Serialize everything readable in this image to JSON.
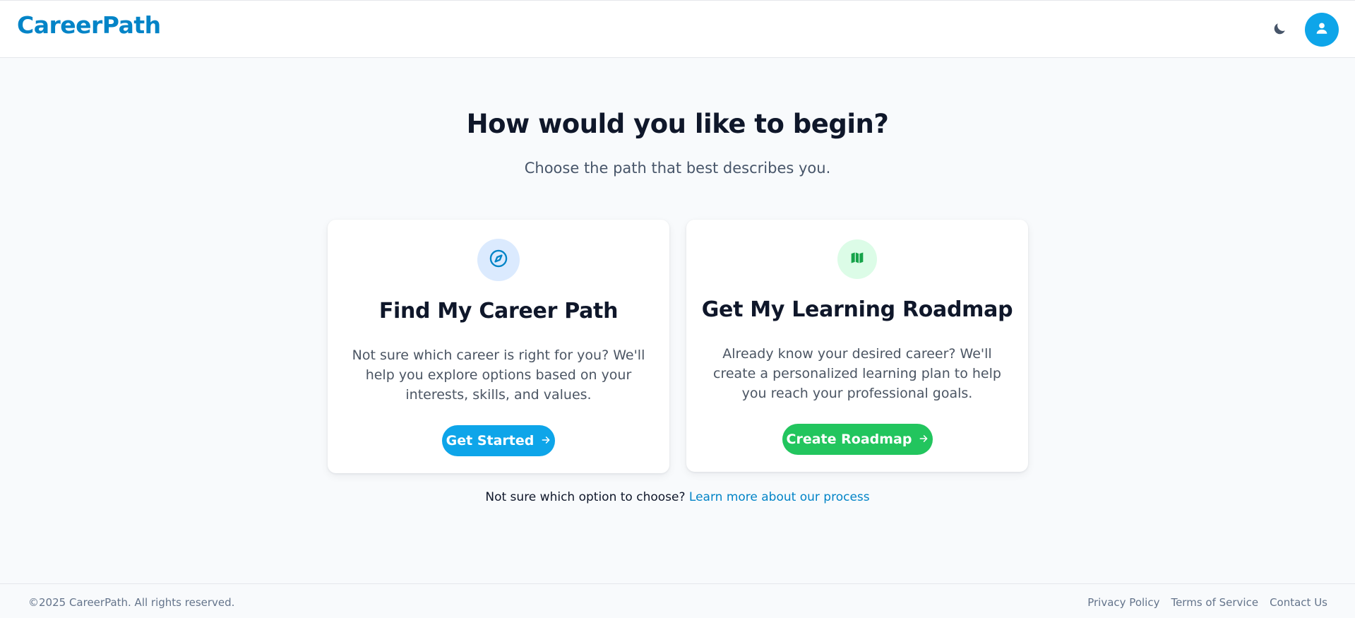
{
  "header": {
    "logo": "CareerPath",
    "theme_toggle_icon": "moon-icon",
    "avatar_icon": "user-icon",
    "colors": {
      "brand": "#0284c7",
      "avatar_bg": "#0ea5e9"
    }
  },
  "hero": {
    "title": "How would you like to begin?",
    "subtitle": "Choose the path that best describes you."
  },
  "cards": [
    {
      "icon": "compass-icon",
      "title": "Find My Career Path",
      "description": "Not sure which career is right for you? We'll help you explore options based on your interests, skills, and values.",
      "cta_label": "Get Started",
      "cta_icon": "arrow-right-icon",
      "accent": "#0ea5e9"
    },
    {
      "icon": "map-icon",
      "title": "Get My Learning Roadmap",
      "description": "Already know your desired career? We'll create a personalized learning plan to help you reach your professional goals.",
      "cta_label": "Create Roadmap",
      "cta_icon": "arrow-right-icon",
      "accent": "#22c55e"
    }
  ],
  "help": {
    "prompt": "Not sure which option to choose?",
    "link_label": "Learn more about our process"
  },
  "footer": {
    "copyright": "©2025 CareerPath. All rights reserved.",
    "links": [
      "Privacy Policy",
      "Terms of Service",
      "Contact Us"
    ]
  }
}
